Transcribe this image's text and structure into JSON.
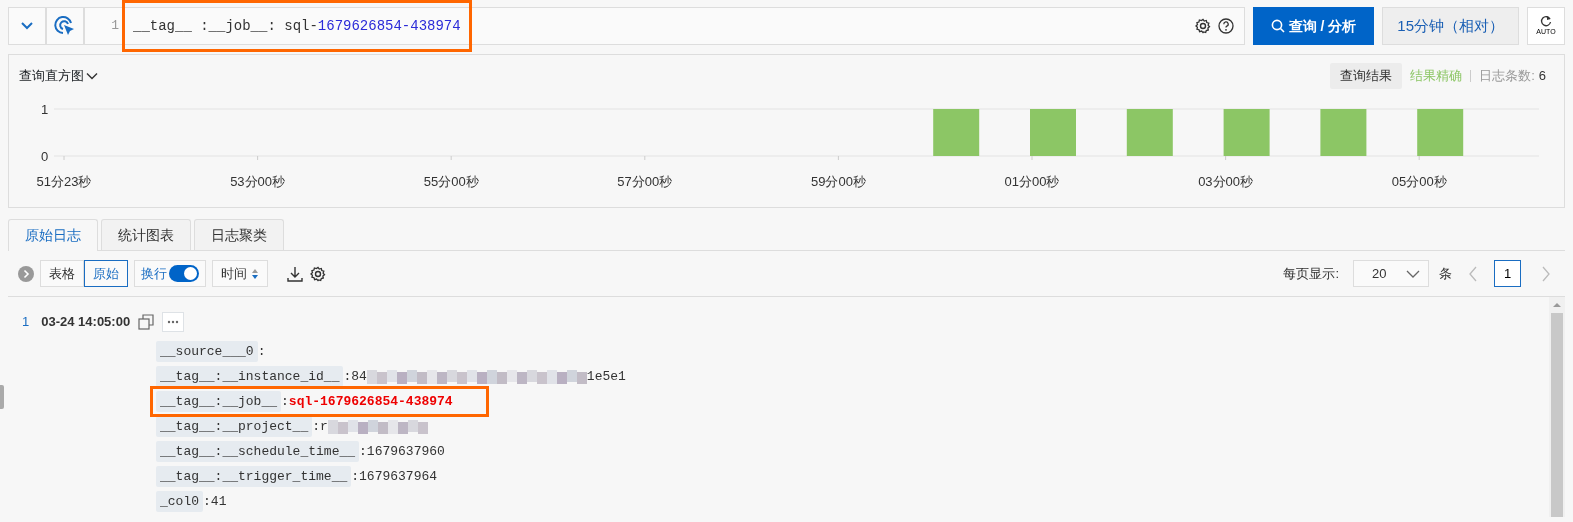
{
  "query_bar": {
    "line_number": "1",
    "query_key": "__tag__ :__job__: sql-",
    "query_value": "1679626854-438974",
    "highlighted": true,
    "search_button": "查询 / 分析",
    "time_range": "15分钟（相对）",
    "refresh_label": "AUTO"
  },
  "histogram": {
    "title": "查询直方图",
    "result_tab": "查询结果",
    "accuracy": "结果精确",
    "count_label": "日志条数:",
    "count": "6",
    "chart_data": {
      "type": "bar",
      "categories": [
        "51分23秒",
        null,
        "53分00秒",
        null,
        "55分00秒",
        null,
        "57分00秒",
        null,
        "59分00秒",
        null,
        "01分00秒",
        null,
        "03分00秒",
        null,
        "05分00秒",
        null
      ],
      "series": [
        {
          "color": "#8cc665",
          "values": [
            0,
            0,
            0,
            0,
            0,
            0,
            0,
            0,
            0,
            1,
            1,
            1,
            1,
            1,
            1,
            0
          ]
        }
      ],
      "ylim": [
        0,
        1
      ],
      "yticks": [
        0,
        1
      ]
    }
  },
  "tabs": [
    {
      "label": "原始日志",
      "selected": true
    },
    {
      "label": "统计图表",
      "selected": false
    },
    {
      "label": "日志聚类",
      "selected": false
    }
  ],
  "toolbar": {
    "view_modes": [
      {
        "label": "表格",
        "selected": false
      },
      {
        "label": "原始",
        "selected": true
      }
    ],
    "wrap": {
      "label": "换行",
      "on": true
    },
    "sort": "时间",
    "page_size_label": "每页显示:",
    "page_size": "20",
    "unit": "条",
    "page": "1"
  },
  "logs": [
    {
      "index": "1",
      "time": "03-24 14:05:00",
      "fields": [
        {
          "key": "__source___0",
          "separator": ":",
          "redacted": false,
          "highlighted": false
        },
        {
          "key": "__tag__:__instance_id__",
          "separator": ":",
          "value": "84",
          "redacted": true,
          "value_tail": "1e5e1",
          "highlighted": false
        },
        {
          "key": "__tag__:__job__",
          "separator": ":",
          "value": "sql-1679626854-438974",
          "redacted": false,
          "highlighted": true
        },
        {
          "key": "__tag__:__project__",
          "separator": ":",
          "value": "r",
          "redacted": true,
          "highlighted": false
        },
        {
          "key": "__tag__:__schedule_time__",
          "separator": ":",
          "value": "1679637960",
          "redacted": false,
          "highlighted": false
        },
        {
          "key": "__tag__:__trigger_time__",
          "separator": ":",
          "value": "1679637964",
          "redacted": false,
          "highlighted": false
        },
        {
          "key": "_col0",
          "separator": ":",
          "value": "41",
          "redacted": false,
          "highlighted": false
        }
      ]
    }
  ]
}
